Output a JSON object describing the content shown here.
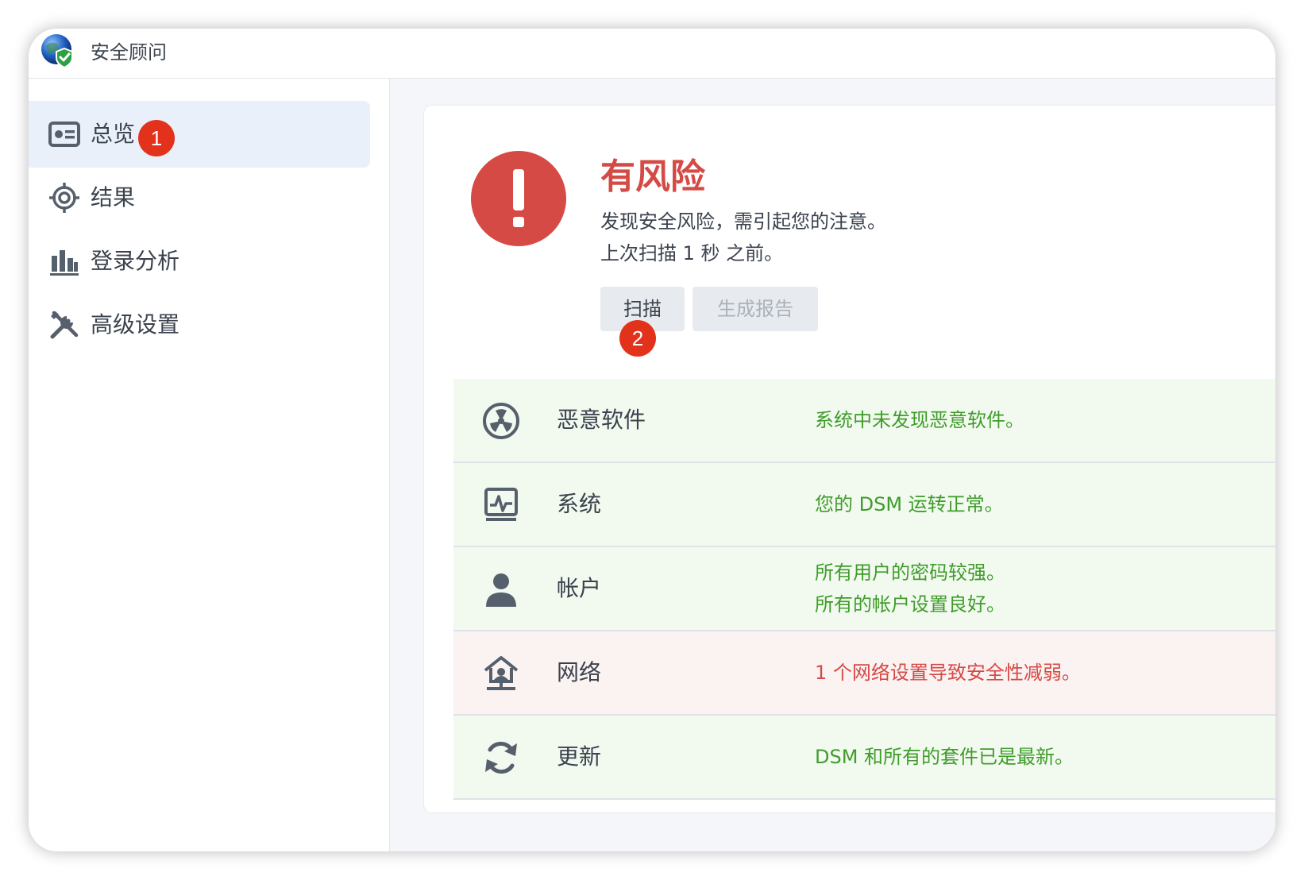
{
  "app": {
    "title": "安全顾问"
  },
  "sidebar": {
    "items": [
      {
        "label": "总览",
        "icon": "overview-card-icon",
        "active": true
      },
      {
        "label": "结果",
        "icon": "crosshair-icon"
      },
      {
        "label": "登录分析",
        "icon": "bar-chart-icon"
      },
      {
        "label": "高级设置",
        "icon": "tools-icon"
      }
    ]
  },
  "annotations": {
    "badge_1": "1",
    "badge_2": "2"
  },
  "overview": {
    "status_title": "有风险",
    "status_desc": "发现安全风险，需引起您的注意。",
    "last_scan": "上次扫描 1 秒 之前。",
    "scan_button": "扫描",
    "report_button": "生成报告"
  },
  "categories": [
    {
      "name": "恶意软件",
      "icon": "radiation-icon",
      "status": [
        "系统中未发现恶意软件。"
      ],
      "state": "ok"
    },
    {
      "name": "系统",
      "icon": "system-monitor-icon",
      "status": [
        "您的 DSM 运转正常。"
      ],
      "state": "ok"
    },
    {
      "name": "帐户",
      "icon": "user-icon",
      "status": [
        "所有用户的密码较强。",
        "所有的帐户设置良好。"
      ],
      "state": "ok"
    },
    {
      "name": "网络",
      "icon": "network-home-icon",
      "status": [
        "1 个网络设置导致安全性减弱。"
      ],
      "state": "warn"
    },
    {
      "name": "更新",
      "icon": "refresh-icon",
      "status": [
        "DSM 和所有的套件已是最新。"
      ],
      "state": "ok"
    }
  ],
  "colors": {
    "danger": "#d54a45",
    "ok_text": "#3f9c2a",
    "ok_row_bg": "#f2faf0",
    "warn_row_bg": "#fbf2f2",
    "badge": "#e3321c",
    "sidebar_active": "#e9f0fa"
  }
}
